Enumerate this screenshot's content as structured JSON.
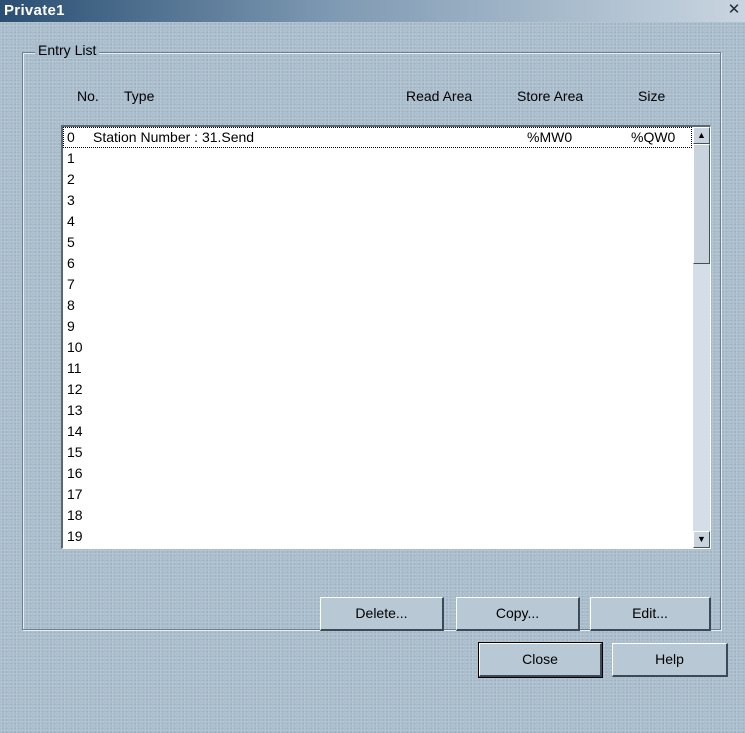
{
  "window": {
    "title": "Private1"
  },
  "group": {
    "label": "Entry List"
  },
  "columns": {
    "no": "No.",
    "type": "Type",
    "read_area": "Read Area",
    "store_area": "Store Area",
    "size": "Size"
  },
  "entries": [
    {
      "no": "0",
      "type": "Station Number : 31.Send",
      "store": "%MW0",
      "size": "%QW0"
    },
    {
      "no": "1",
      "type": "",
      "store": "",
      "size": ""
    },
    {
      "no": "2",
      "type": "",
      "store": "",
      "size": ""
    },
    {
      "no": "3",
      "type": "",
      "store": "",
      "size": ""
    },
    {
      "no": "4",
      "type": "",
      "store": "",
      "size": ""
    },
    {
      "no": "5",
      "type": "",
      "store": "",
      "size": ""
    },
    {
      "no": "6",
      "type": "",
      "store": "",
      "size": ""
    },
    {
      "no": "7",
      "type": "",
      "store": "",
      "size": ""
    },
    {
      "no": "8",
      "type": "",
      "store": "",
      "size": ""
    },
    {
      "no": "9",
      "type": "",
      "store": "",
      "size": ""
    },
    {
      "no": "10",
      "type": "",
      "store": "",
      "size": ""
    },
    {
      "no": "11",
      "type": "",
      "store": "",
      "size": ""
    },
    {
      "no": "12",
      "type": "",
      "store": "",
      "size": ""
    },
    {
      "no": "13",
      "type": "",
      "store": "",
      "size": ""
    },
    {
      "no": "14",
      "type": "",
      "store": "",
      "size": ""
    },
    {
      "no": "15",
      "type": "",
      "store": "",
      "size": ""
    },
    {
      "no": "16",
      "type": "",
      "store": "",
      "size": ""
    },
    {
      "no": "17",
      "type": "",
      "store": "",
      "size": ""
    },
    {
      "no": "18",
      "type": "",
      "store": "",
      "size": ""
    },
    {
      "no": "19",
      "type": "",
      "store": "",
      "size": ""
    }
  ],
  "actions": {
    "delete": "Delete...",
    "copy": "Copy...",
    "edit": "Edit..."
  },
  "footer": {
    "close": "Close",
    "help": "Help"
  },
  "icons": {
    "close": "close-icon",
    "scroll_up": "scroll-up-arrow-icon",
    "scroll_down": "scroll-down-arrow-icon"
  }
}
